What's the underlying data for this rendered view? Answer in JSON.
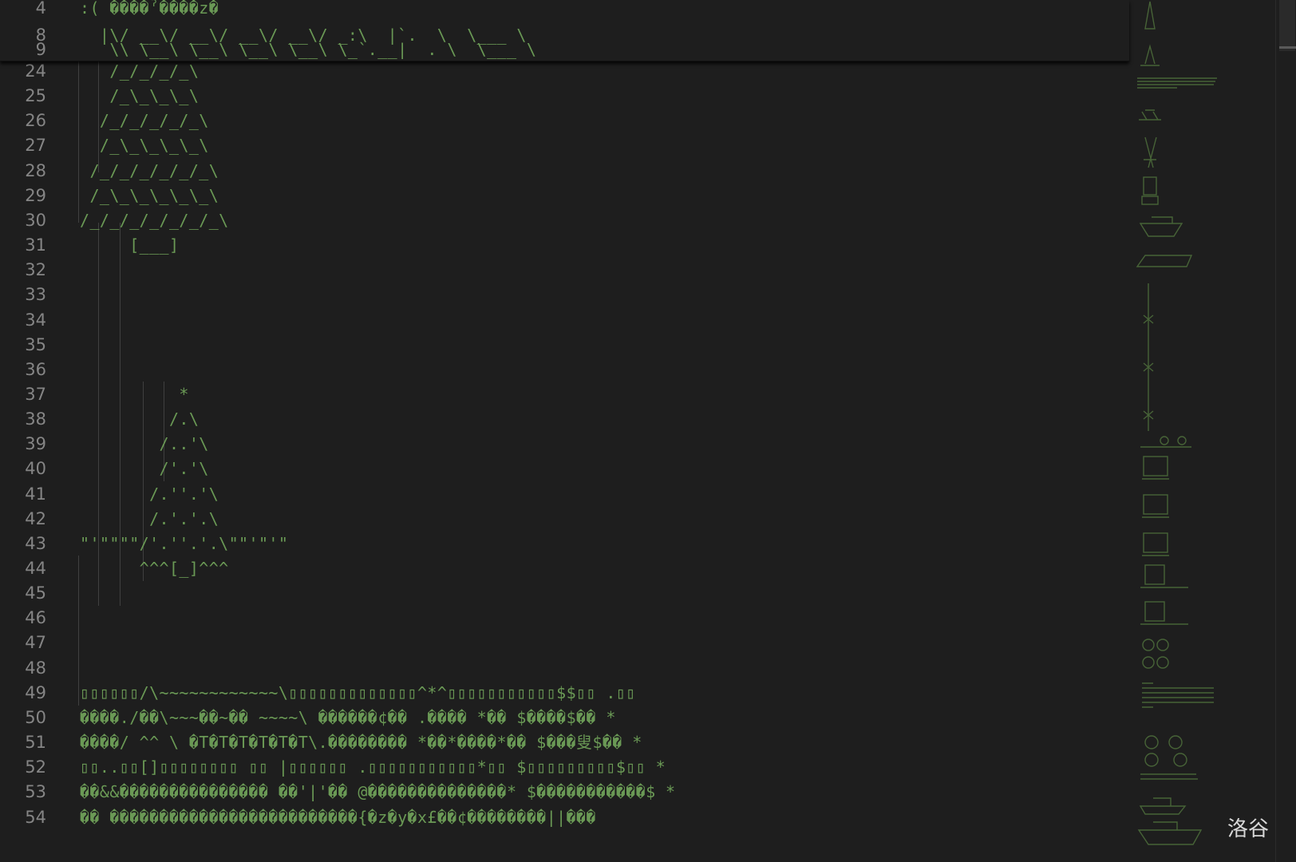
{
  "colors": {
    "background": "#1e1e1e",
    "line_number": "#858585",
    "code_text": "#6a9955",
    "indent_guide": "#404040"
  },
  "sticky_lines": [
    {
      "num": "4",
      "text": ":( ����ˀ����z�"
    },
    {
      "num": "8",
      "text": "  |\\/ __\\/ __\\/ __\\/ __\\/ _:\\  |`.  \\  \\___ \\"
    },
    {
      "num": "9",
      "text": "   \\\\ \\__\\ \\__\\ \\__\\ \\__\\ \\_`.__|  . \\  \\___ \\"
    }
  ],
  "lines": [
    {
      "num": "24",
      "text": "   /_/_/_/_\\"
    },
    {
      "num": "25",
      "text": "   /_\\_\\_\\_\\"
    },
    {
      "num": "26",
      "text": "  /_/_/_/_/_\\"
    },
    {
      "num": "27",
      "text": "  /_\\_\\_\\_\\_\\"
    },
    {
      "num": "28",
      "text": " /_/_/_/_/_/_\\"
    },
    {
      "num": "29",
      "text": " /_\\_\\_\\_\\_\\_\\"
    },
    {
      "num": "30",
      "text": "/_/_/_/_/_/_/_\\"
    },
    {
      "num": "31",
      "text": "     [___]"
    },
    {
      "num": "32",
      "text": ""
    },
    {
      "num": "33",
      "text": ""
    },
    {
      "num": "34",
      "text": ""
    },
    {
      "num": "35",
      "text": ""
    },
    {
      "num": "36",
      "text": ""
    },
    {
      "num": "37",
      "text": "          *"
    },
    {
      "num": "38",
      "text": "         /.\\"
    },
    {
      "num": "39",
      "text": "        /..'\\"
    },
    {
      "num": "40",
      "text": "        /'.'\\"
    },
    {
      "num": "41",
      "text": "       /.''.'\\"
    },
    {
      "num": "42",
      "text": "       /.'.'.\\"
    },
    {
      "num": "43",
      "text": "\"'\"\"\"\"/'.''.'.\\\"\"'\"'\""
    },
    {
      "num": "44",
      "text": "      ^^^[_]^^^"
    },
    {
      "num": "45",
      "text": ""
    },
    {
      "num": "46",
      "text": ""
    },
    {
      "num": "47",
      "text": ""
    },
    {
      "num": "48",
      "text": ""
    },
    {
      "num": "49",
      "text": "▯▯▯▯▯▯/\\~~~~~~~~~~~~\\▯▯▯▯▯▯▯▯▯▯▯▯▯^*^▯▯▯▯▯▯▯▯▯▯▯$$▯▯ .▯▯"
    },
    {
      "num": "50",
      "text": "����./��\\~~~��~�� ~~~~\\ ������¢�� .���� *�� $����$�� *"
    },
    {
      "num": "51",
      "text": "����/ ^^ \\ �T�T�T�T�T�T\\.�������� *��*����*�� $���叟$�� *"
    },
    {
      "num": "52",
      "text": "▯▯..▯▯[]▯▯▯▯▯▯▯▯ ▯▯ |▯▯▯▯▯▯ .▯▯▯▯▯▯▯▯▯▯▯*▯▯ $▯▯▯▯▯▯▯▯▯$▯▯ *"
    },
    {
      "num": "53",
      "text": "��&&��������������� ��'|'�� @��������������* $�����������$ *"
    },
    {
      "num": "54",
      "text": "�� �������������������������{�z�y�x£��¢��������||���"
    }
  ],
  "watermark": "洛谷"
}
